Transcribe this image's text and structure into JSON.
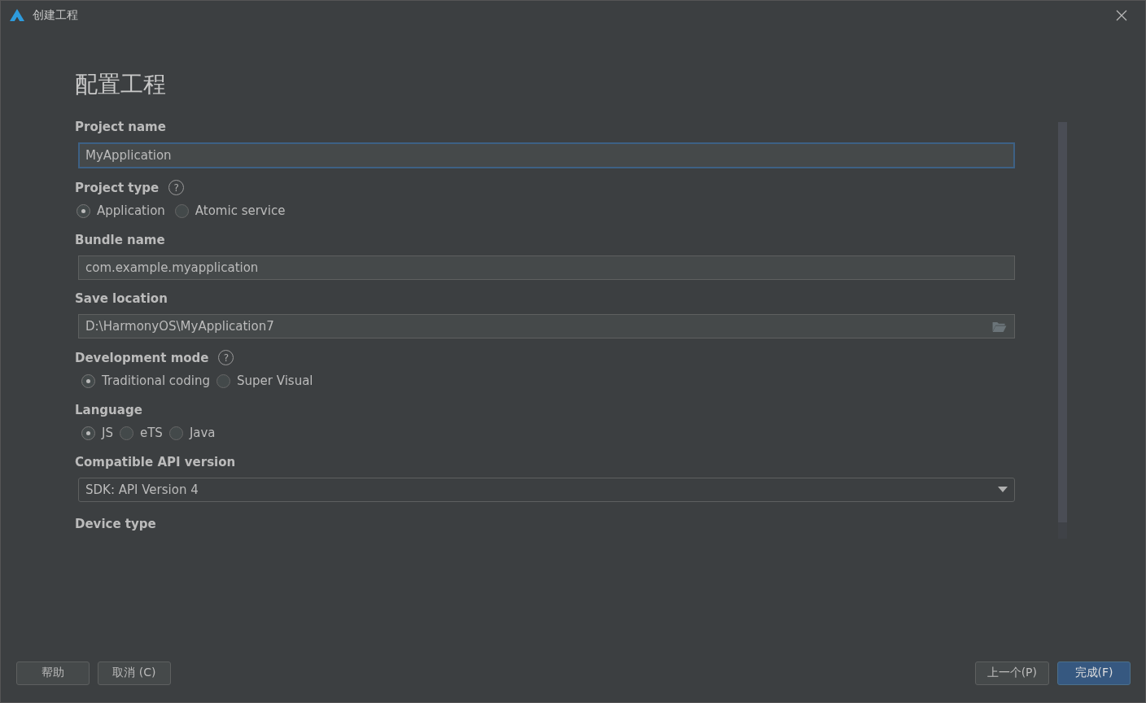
{
  "window": {
    "title": "创建工程"
  },
  "heading": "配置工程",
  "fields": [
    {
      "kind": "text",
      "label": "Project name",
      "value": "MyApplication",
      "focused": true
    },
    {
      "kind": "radio",
      "label": "Project type",
      "help": "?",
      "options": [
        {
          "label": "Application",
          "selected": true
        },
        {
          "label": "Atomic service",
          "selected": false
        }
      ]
    },
    {
      "kind": "text",
      "label": "Bundle name",
      "value": "com.example.myapplication",
      "focused": false
    },
    {
      "kind": "path",
      "label": "Save location",
      "value": "D:\\HarmonyOS\\MyApplication7",
      "focused": false
    },
    {
      "kind": "radio",
      "label": "Development mode",
      "help": "?",
      "options": [
        {
          "label": "Traditional coding",
          "selected": true
        },
        {
          "label": "Super Visual",
          "selected": false
        }
      ]
    },
    {
      "kind": "radio",
      "label": "Language",
      "options": [
        {
          "label": "JS",
          "selected": true
        },
        {
          "label": "eTS",
          "selected": false
        },
        {
          "label": "Java",
          "selected": false
        }
      ]
    },
    {
      "kind": "dropdown",
      "label": "Compatible API version",
      "value": "SDK: API Version 4"
    },
    {
      "kind": "heading",
      "label": "Device type"
    }
  ],
  "left_buttons": [
    {
      "label": "帮助",
      "primary": false
    },
    {
      "label": "取消 (C)",
      "primary": false
    }
  ],
  "right_buttons": [
    {
      "label": "上一个(P)",
      "primary": false
    },
    {
      "label": "完成(F)",
      "primary": true
    }
  ]
}
